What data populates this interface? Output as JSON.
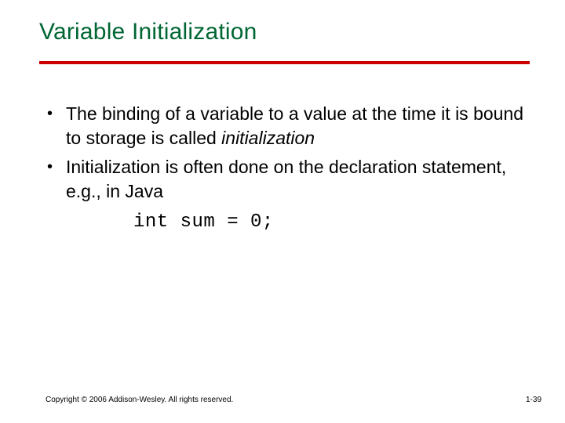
{
  "title": "Variable Initialization",
  "bullets": [
    {
      "dot": "•",
      "text_before": "The binding of a variable to a value at the time it is bound to storage is called ",
      "italic": "initialization",
      "text_after": ""
    },
    {
      "dot": "•",
      "text_before": "Initialization is often done on the declaration statement, e.g., in Java",
      "italic": "",
      "text_after": ""
    }
  ],
  "code": "int sum = 0;",
  "footer": {
    "copyright": "Copyright © 2006 Addison-Wesley. All rights reserved.",
    "page": "1-39"
  }
}
